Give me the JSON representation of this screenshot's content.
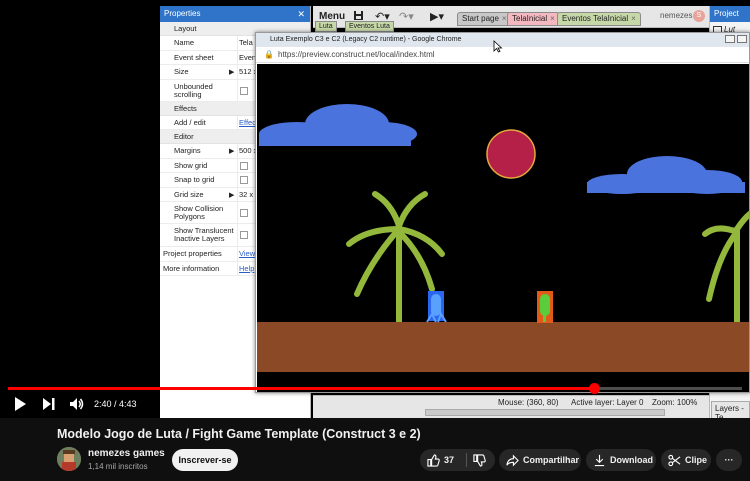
{
  "editor": {
    "menu_label": "Menu",
    "tabs": [
      {
        "label": "Start page",
        "color": "#c8c8c8"
      },
      {
        "label": "TelaInicial",
        "color": "#f4b8c0"
      },
      {
        "label": "Eventos TelaInicial",
        "color": "#c7d8a8"
      }
    ],
    "subtabs": [
      "Luta",
      "Eventos Luta"
    ],
    "user_name": "nemezes",
    "user_badge": "S",
    "project_panel": {
      "title": "Project",
      "item": "Lut"
    },
    "properties": {
      "title": "Properties",
      "sections": {
        "layout": "Layout",
        "effects": "Effects",
        "editor": "Editor"
      },
      "rows": {
        "name": {
          "label": "Name",
          "value": "Tela"
        },
        "event_sheet": {
          "label": "Event sheet",
          "value": "Even"
        },
        "size": {
          "label": "Size",
          "value": "512 x"
        },
        "unbounded": {
          "label": "Unbounded scrolling"
        },
        "add_edit": {
          "label": "Add / edit",
          "value": "Effec"
        },
        "margins": {
          "label": "Margins",
          "value": "500 x"
        },
        "show_grid": {
          "label": "Show grid"
        },
        "snap_grid": {
          "label": "Snap to grid"
        },
        "grid_size": {
          "label": "Grid size",
          "value": "32 x"
        },
        "collision": {
          "label": "Show Collision Polygons"
        },
        "translucent": {
          "label": "Show Translucent Inactive Layers"
        },
        "project_props": {
          "label": "Project properties",
          "value": "View"
        },
        "more_info": {
          "label": "More information",
          "value": "Help"
        }
      }
    },
    "status": {
      "mouse": "Mouse: (360, 80)",
      "active_layer": "Active layer: Layer 0",
      "zoom": "Zoom: 100%"
    },
    "layers_tab": "Layers - Te"
  },
  "chrome": {
    "window_title": "Luta Exemplo C3 e C2 (Legacy C2 runtime) - Google Chrome",
    "url": "https://preview.construct.net/local/index.html"
  },
  "colors": {
    "sky": "#000000",
    "cloud": "#4b73de",
    "sun": "#b42048",
    "sun_ring": "#e6a83c",
    "palm": "#93b83c",
    "ground": "#8b4a25",
    "fighter_blue": "#2a66f0",
    "fighter_green": "#5ccd3a",
    "fighter_green_frame": "#e25a1a",
    "accent_red": "#ff0000"
  },
  "player": {
    "current_time": "2:40",
    "duration": "4:43",
    "time_display": "2:40 / 4:43",
    "progress_fraction": 0.798,
    "buffered_fraction": 0.875
  },
  "video": {
    "title": "Modelo Jogo de Luta / Fight Game Template (Construct 3 e 2)",
    "channel": "nemezes games",
    "subscribers": "1,14 mil inscritos",
    "subscribe_label": "Inscrever-se",
    "likes": "37",
    "share_label": "Compartilhar",
    "download_label": "Download",
    "clip_label": "Clipe",
    "more_label": "···"
  }
}
